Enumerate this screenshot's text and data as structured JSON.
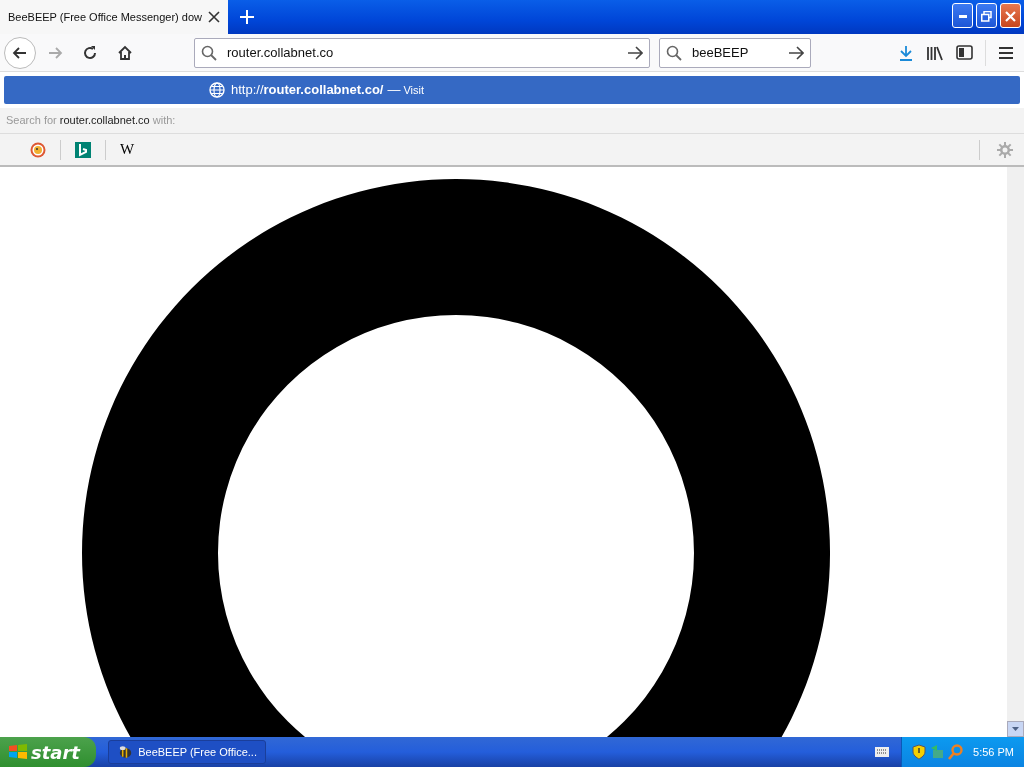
{
  "tabs": [
    {
      "title": "BeeBEEP (Free Office Messenger) dow",
      "selected": true
    }
  ],
  "nav_buttons": [
    {
      "kind": "back",
      "disabled": false
    },
    {
      "kind": "forward",
      "disabled": true
    },
    {
      "kind": "reload",
      "disabled": false
    },
    {
      "kind": "home",
      "disabled": false
    }
  ],
  "url_field": {
    "value": "router.collabnet.co"
  },
  "search_field": {
    "value": "beeBEEP"
  },
  "suggestion": {
    "url": "http://**router.collabnet.co/**",
    "separator": "—",
    "action": "Visit",
    "selected": true
  },
  "search_with": {
    "prefix": "Search for",
    "query": "router.collabnet.co",
    "suffix": "with:"
  },
  "engines": [
    {
      "kind": "duckduckgo"
    },
    {
      "kind": "bing"
    },
    {
      "kind": "wikipedia",
      "label": "W"
    }
  ],
  "taskbar": {
    "start": "start",
    "task": "BeeBEEP (Free Office...",
    "clock": "5:56 PM"
  }
}
